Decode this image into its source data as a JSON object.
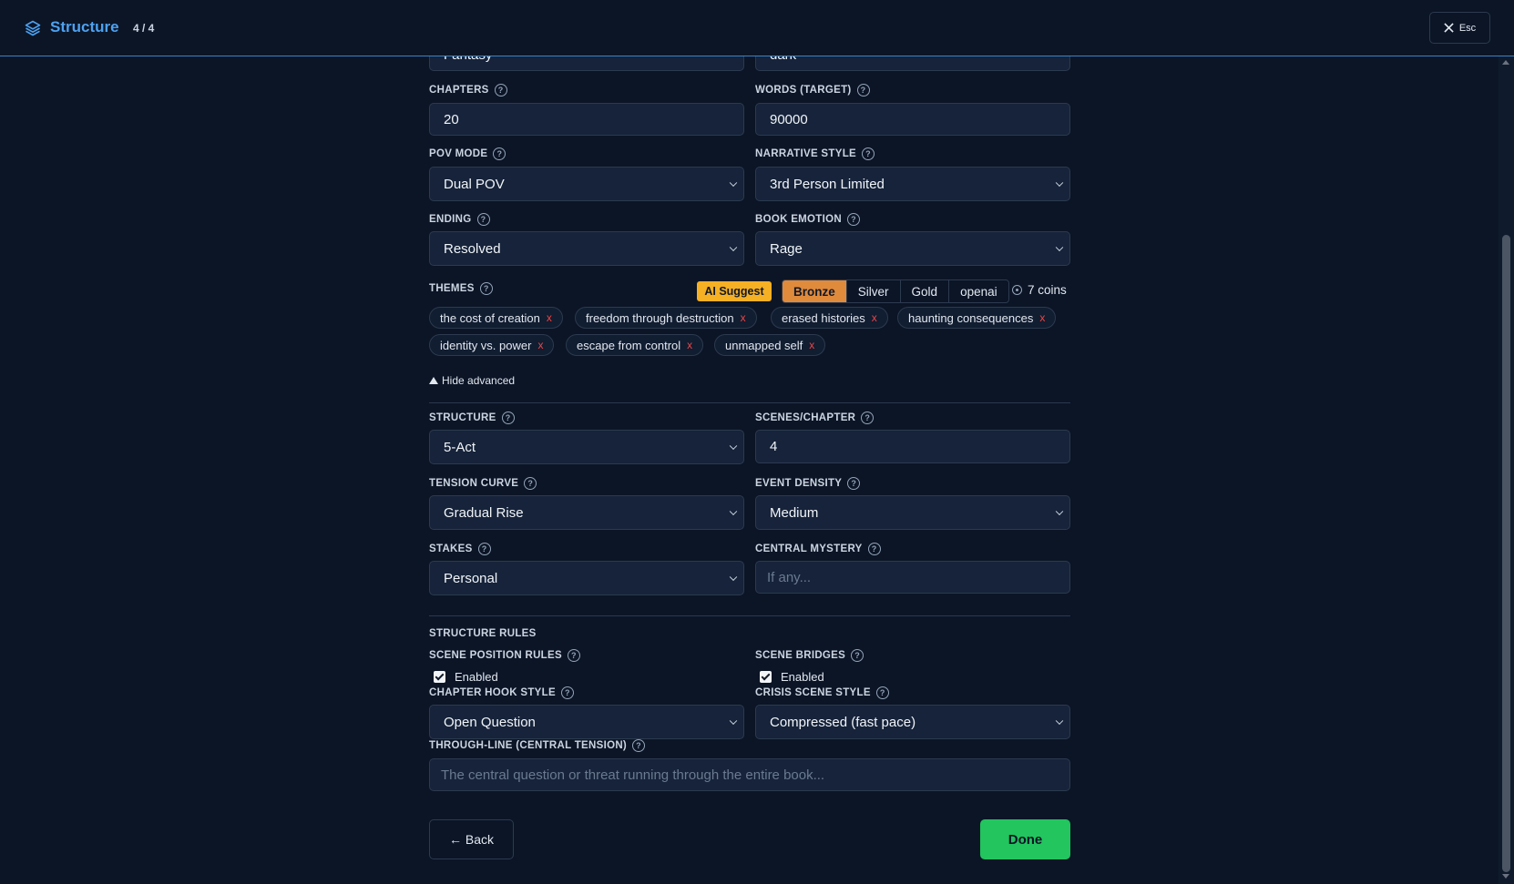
{
  "header": {
    "title": "Structure",
    "step": "4 / 4",
    "esc_label": "Esc"
  },
  "top_partial": {
    "genre_value": "Fantasy",
    "tone_value": "dark"
  },
  "chapters": {
    "label": "CHAPTERS",
    "value": "20"
  },
  "words": {
    "label": "WORDS (TARGET)",
    "value": "90000"
  },
  "pov": {
    "label": "POV MODE",
    "value": "Dual POV"
  },
  "narrative": {
    "label": "NARRATIVE STYLE",
    "value": "3rd Person Limited"
  },
  "ending": {
    "label": "ENDING",
    "value": "Resolved"
  },
  "emotion": {
    "label": "BOOK EMOTION",
    "value": "Rage"
  },
  "themes": {
    "label": "THEMES",
    "ai_suggest": "AI Suggest",
    "tiers": [
      "Bronze",
      "Silver",
      "Gold",
      "openai"
    ],
    "active_tier": "Bronze",
    "coins": "7 coins",
    "chips": [
      "the cost of creation",
      "freedom through destruction",
      "erased histories",
      "haunting consequences",
      "identity vs. power",
      "escape from control",
      "unmapped self"
    ],
    "remove_glyph": "x"
  },
  "advanced_toggle": "Hide advanced",
  "structure": {
    "label": "STRUCTURE",
    "value": "5-Act"
  },
  "scenes": {
    "label": "SCENES/CHAPTER",
    "value": "4"
  },
  "tension": {
    "label": "TENSION CURVE",
    "value": "Gradual Rise"
  },
  "density": {
    "label": "EVENT DENSITY",
    "value": "Medium"
  },
  "stakes": {
    "label": "STAKES",
    "value": "Personal"
  },
  "mystery": {
    "label": "CENTRAL MYSTERY",
    "placeholder": "If any..."
  },
  "rules": {
    "title": "STRUCTURE RULES",
    "scene_position": {
      "label": "SCENE POSITION RULES",
      "check_label": "Enabled",
      "checked": true
    },
    "scene_bridges": {
      "label": "SCENE BRIDGES",
      "check_label": "Enabled",
      "checked": true
    },
    "hook": {
      "label": "CHAPTER HOOK STYLE",
      "value": "Open Question"
    },
    "crisis": {
      "label": "CRISIS SCENE STYLE",
      "value": "Compressed (fast pace)"
    },
    "throughline": {
      "label": "THROUGH-LINE (CENTRAL TENSION)",
      "placeholder": "The central question or threat running through the entire book..."
    }
  },
  "help_glyph": "?",
  "footer": {
    "back_label": "← Back",
    "done_label": "Done"
  },
  "colors": {
    "accent": "#4ea1f0",
    "done": "#22c55e",
    "ai": "#f5b024",
    "bronze": "#e08a3c",
    "remove": "#ef4444"
  }
}
